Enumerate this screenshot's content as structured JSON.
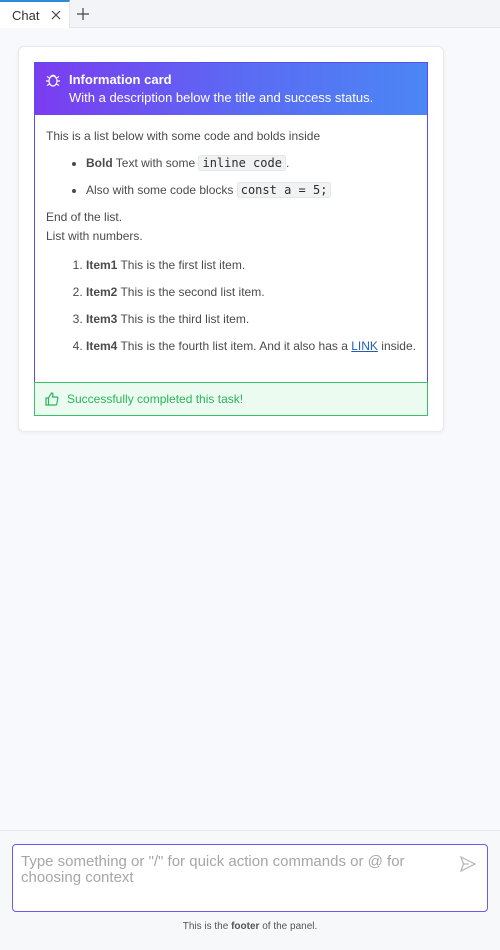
{
  "tabs": [
    {
      "label": "Chat"
    }
  ],
  "card": {
    "title": "Information card",
    "description": "With a description below the title and success status.",
    "intro": "This is a list below with some code and bolds inside",
    "bullets": [
      {
        "bold": "Bold",
        "text": " Text with some ",
        "code": "inline code",
        "suffix": "."
      },
      {
        "text": "Also with some code blocks ",
        "code": "const a = 5;"
      }
    ],
    "end_text": "End of the list.",
    "numbers_text": "List with numbers.",
    "numbered": [
      {
        "bold": "Item1",
        "text": " This is the first list item."
      },
      {
        "bold": "Item2",
        "text": " This is the second list item."
      },
      {
        "bold": "Item3",
        "text": " This is the third list item."
      },
      {
        "bold": "Item4",
        "text": " This is the fourth list item. And it also has a ",
        "link": "LINK",
        "suffix": " inside."
      }
    ],
    "status_text": "Successfully completed this task!",
    "colors": {
      "header_start": "#7b3cf0",
      "header_end": "#4b86f5",
      "success": "#2bb55d"
    }
  },
  "prompt": {
    "placeholder": "Type something or \"/\" for quick action commands or @ for choosing context"
  },
  "footer": {
    "prefix": "This is the ",
    "bold": "footer",
    "suffix": " of the panel."
  },
  "icons": {
    "card": "bug-icon",
    "status": "thumbs-up-icon",
    "send": "send-icon",
    "close": "close-icon",
    "add": "plus-icon"
  }
}
